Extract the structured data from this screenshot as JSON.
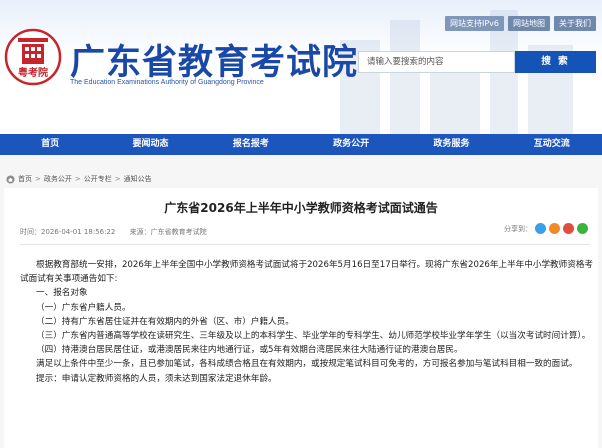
{
  "header": {
    "top_links": [
      "网站支持IPv6",
      "网站地图",
      "关于我们"
    ],
    "title": "广东省教育考试院",
    "subtitle": "The Education Examinations Authority of Guangdong Province",
    "logo_text": "粤考院"
  },
  "search": {
    "placeholder": "请输入要搜索的内容",
    "button_label": "搜 索"
  },
  "nav": {
    "items": [
      "首页",
      "要闻动态",
      "报名报考",
      "政务公开",
      "政务服务",
      "互动交流"
    ]
  },
  "breadcrumb": {
    "items": [
      "首页",
      "政务公开",
      "公开专栏",
      "通知公告"
    ],
    "separator": ">"
  },
  "article": {
    "title": "广东省2026年上半年中小学教师资格考试面试通告",
    "time": "时间：2026-04-01 18:56:22",
    "source": "来源：广东省教育考试院",
    "share_label": "分享到：",
    "share_colors": [
      "#3b9ee8",
      "#f08a24",
      "#e44b3f",
      "#3cb43c"
    ],
    "paragraphs": [
      "根据教育部统一安排，2026年上半年全国中小学教师资格考试面试将于2026年5月16日至17日举行。现将广东省2026年上半年中小学教师资格考试面试有关事项通告如下:",
      "一、报名对象",
      "（一）广东省户籍人员。",
      "（二）持有广东省居住证并在有效期内的外省（区、市）户籍人员。",
      "（三）广东省内普通高等学校在读研究生、三年级及以上的本科学生、毕业学年的专科学生、幼儿师范学校毕业学年学生（以当次考试时间计算）。",
      "（四）持港澳台居民居住证，或港澳居民来往内地通行证，或5年有效期台湾居民来往大陆通行证的港澳台居民。",
      "满足以上条件中至少一条，且已参加笔试，各科成绩合格且在有效期内，或按规定笔试科目可免考的，方可报名参加与笔试科目相一致的面试。",
      "提示：申请认定教师资格的人员，须未达到国家法定退休年龄。"
    ]
  }
}
